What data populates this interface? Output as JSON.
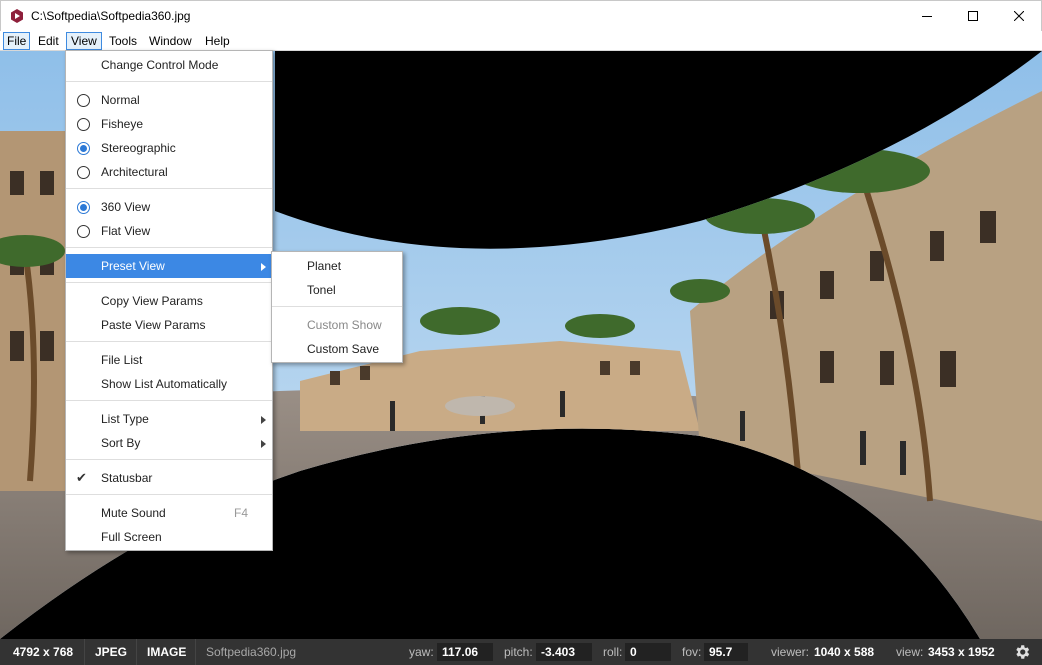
{
  "window": {
    "title": "C:\\Softpedia\\Softpedia360.jpg"
  },
  "menubar": {
    "items": [
      "File",
      "Edit",
      "View",
      "Tools",
      "Window",
      "Help"
    ],
    "active": "View"
  },
  "view_menu": {
    "change_control_mode": "Change Control Mode",
    "normal": "Normal",
    "fisheye": "Fisheye",
    "stereographic": "Stereographic",
    "architectural": "Architectural",
    "view360": "360 View",
    "flat_view": "Flat View",
    "preset_view": "Preset View",
    "copy_view_params": "Copy View Params",
    "paste_view_params": "Paste View Params",
    "file_list": "File List",
    "show_list_automatically": "Show List Automatically",
    "list_type": "List Type",
    "sort_by": "Sort By",
    "statusbar": "Statusbar",
    "mute_sound": "Mute Sound",
    "mute_sound_shortcut": "F4",
    "full_screen": "Full Screen"
  },
  "preset_submenu": {
    "planet": "Planet",
    "tonel": "Tonel",
    "custom_show": "Custom Show",
    "custom_save": "Custom Save"
  },
  "statusbar": {
    "dimensions": "4792 x 768",
    "format": "JPEG",
    "kind": "IMAGE",
    "filename": "Softpedia360.jpg",
    "yaw_label": "yaw:",
    "yaw": "117.06",
    "pitch_label": "pitch:",
    "pitch": "-3.403",
    "roll_label": "roll:",
    "roll": "0",
    "fov_label": "fov:",
    "fov": "95.7",
    "viewer_label": "viewer:",
    "viewer": "1040 x 588",
    "view_label": "view:",
    "view": "3453 x 1952"
  },
  "colors": {
    "highlight": "#3c88e4",
    "statusbar_bg": "#333333",
    "radio_accent": "#2c79d6"
  }
}
